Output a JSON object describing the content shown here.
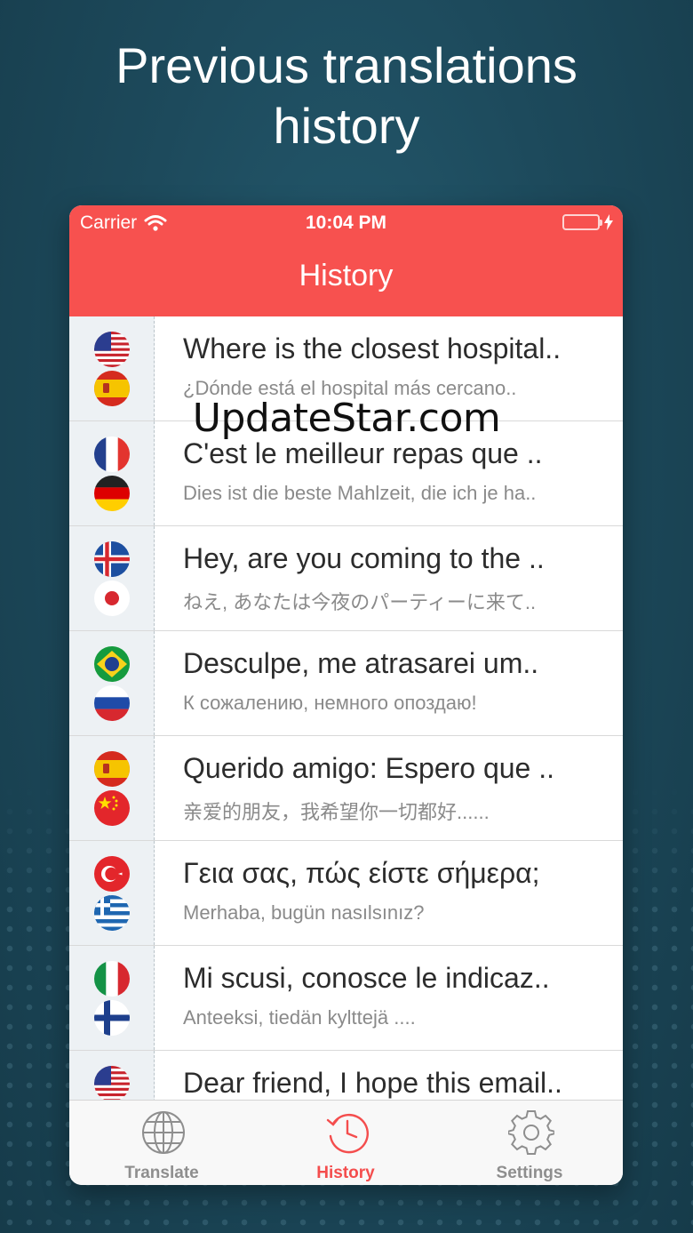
{
  "headline": {
    "line1": "Previous translations",
    "line2": "history"
  },
  "status": {
    "carrier": "Carrier",
    "time": "10:04 PM"
  },
  "nav": {
    "title": "History"
  },
  "history": [
    {
      "source": "Where is the closest hospital..",
      "translation": "¿Dónde está el hospital más cercano..",
      "from_flag": "usa-flag-icon",
      "to_flag": "spain-flag-icon"
    },
    {
      "source": "C'est le meilleur repas que ..",
      "translation": "Dies ist die beste Mahlzeit, die ich je ha..",
      "from_flag": "france-flag-icon",
      "to_flag": "germany-flag-icon"
    },
    {
      "source": "Hey, are you coming to the ..",
      "translation": "ねえ, あなたは今夜のパーティーに来て..",
      "from_flag": "iceland-flag-icon",
      "to_flag": "japan-flag-icon"
    },
    {
      "source": "Desculpe, me atrasarei um..",
      "translation": "К сожалению, немного опоздаю!",
      "from_flag": "brazil-flag-icon",
      "to_flag": "russia-flag-icon"
    },
    {
      "source": "Querido amigo: Espero que ..",
      "translation": "亲爱的朋友，我希望你一切都好......",
      "from_flag": "spain-flag-icon",
      "to_flag": "china-flag-icon"
    },
    {
      "source": "Γεια σας, πώς είστε σήμερα;",
      "translation": "Merhaba, bugün nasılsınız?",
      "from_flag": "turkey-flag-icon",
      "to_flag": "greece-flag-icon"
    },
    {
      "source": "Mi scusi, conosce le indicaz..",
      "translation": "Anteeksi, tiedän kylttejä ....",
      "from_flag": "italy-flag-icon",
      "to_flag": "finland-flag-icon"
    },
    {
      "source": "Dear friend, I hope this email..",
      "translation": "",
      "from_flag": "usa-flag-icon",
      "to_flag": ""
    }
  ],
  "watermark": "UpdateStar.com",
  "tabs": [
    {
      "label": "Translate",
      "icon": "globe-icon",
      "active": false
    },
    {
      "label": "History",
      "icon": "clock-history-icon",
      "active": true
    },
    {
      "label": "Settings",
      "icon": "gear-icon",
      "active": false
    }
  ],
  "colors": {
    "accent": "#f7514f",
    "background": "#1d4a5c",
    "tab_active": "#f44d4d",
    "tab_inactive": "#8e8e8e"
  }
}
